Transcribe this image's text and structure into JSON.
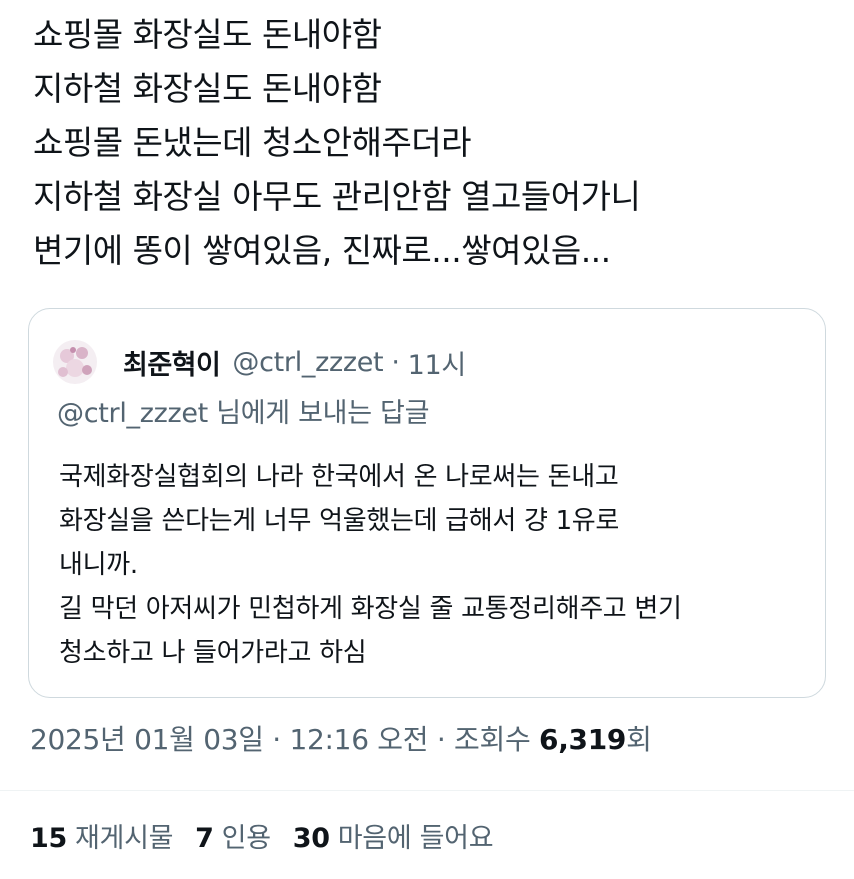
{
  "tweet": {
    "lines": [
      "쇼핑몰 화장실도 돈내야함",
      "지하철 화장실도 돈내야함",
      "쇼핑몰 돈냈는데 청소안해주더라",
      "지하철 화장실 아무도 관리안함 열고들어가니",
      "변기에 똥이 쌓여있음, 진짜로...쌓여있음..."
    ]
  },
  "quote": {
    "avatar_icon": "avatar-image",
    "name": "최준혁이",
    "handle": "@ctrl_zzzet",
    "separator": "·",
    "time": "11시",
    "reply_to": "@ctrl_zzzet 님에게 보내는 답글",
    "lines": [
      "국제화장실협회의 나라 한국에서 온 나로써는 돈내고",
      "화장실을 쓴다는게 너무 억울했는데 급해서 걍 1유로",
      "내니까.",
      "길 막던 아저씨가 민첩하게 화장실 줄 교통정리해주고 변기",
      "청소하고 나 들어가라고 하심"
    ]
  },
  "meta": {
    "date": "2025년 01월 03일",
    "sep1": " · ",
    "time": "12:16 오전",
    "sep2": " · ",
    "views_label": "조회수 ",
    "views_count": "6,319",
    "views_suffix": "회"
  },
  "stats": {
    "retweets": {
      "count": "15",
      "label": "재게시물"
    },
    "quotes": {
      "count": "7",
      "label": "인용"
    },
    "likes": {
      "count": "30",
      "label": "마음에 들어요"
    }
  },
  "colors": {
    "text": "#0f1419",
    "secondary": "#536471",
    "border": "#cfd9de"
  }
}
